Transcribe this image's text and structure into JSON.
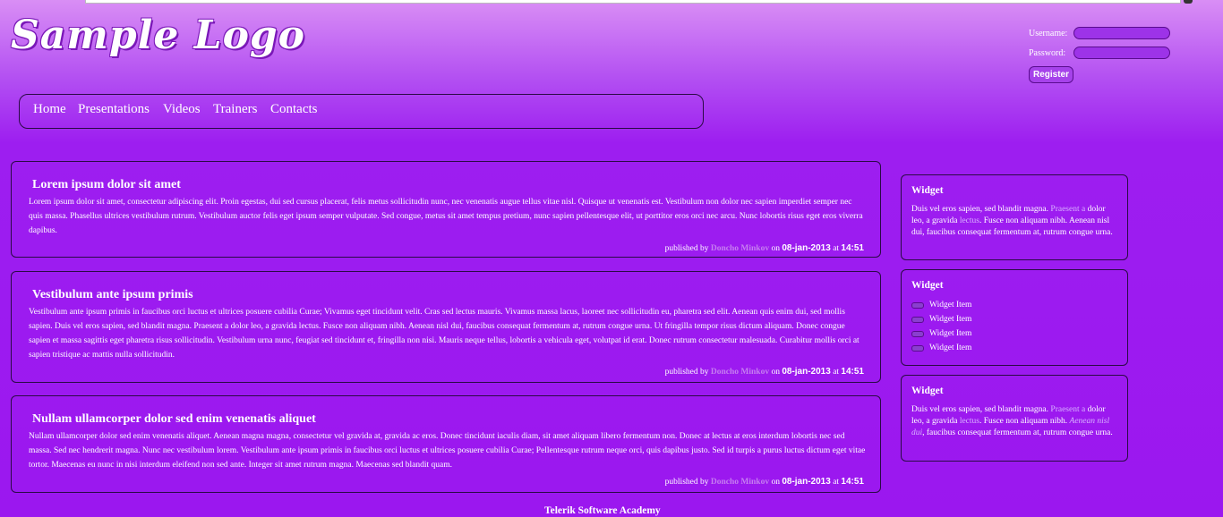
{
  "logo": "Sample Logo",
  "login": {
    "username_label": "Username:",
    "password_label": "Password:",
    "register_label": "Register"
  },
  "nav": [
    "Home",
    "Presentations",
    "Videos",
    "Trainers",
    "Contacts"
  ],
  "articles": [
    {
      "title": "Lorem ipsum dolor sit amet",
      "body": "Lorem ipsum dolor sit amet, consectetur adipiscing elit. Proin egestas, dui sed cursus placerat, felis metus sollicitudin nunc, nec venenatis augue tellus vitae nisl. Quisque ut venenatis est. Vestibulum non dolor nec sapien imperdiet semper nec quis massa. Phasellus ultrices vestibulum rutrum. Vestibulum auctor felis eget ipsum semper vulputate. Sed congue, metus sit amet tempus pretium, nunc sapien pellentesque elit, ut porttitor eros orci nec arcu. Nunc lobortis risus eget eros viverra dapibus.",
      "author": "Doncho Minkov",
      "date": "08-jan-2013",
      "time": "14:51"
    },
    {
      "title": "Vestibulum ante ipsum primis",
      "body": "Vestibulum ante ipsum primis in faucibus orci luctus et ultrices posuere cubilia Curae; Vivamus eget tincidunt velit. Cras sed lectus mauris. Vivamus massa lacus, laoreet nec sollicitudin eu, pharetra sed elit. Aenean quis enim dui, sed mollis sapien. Duis vel eros sapien, sed blandit magna. Praesent a dolor leo, a gravida lectus. Fusce non aliquam nibh. Aenean nisl dui, faucibus consequat fermentum at, rutrum congue urna. Ut fringilla tempor risus dictum aliquam. Donec congue sapien et massa sagittis eget pharetra risus sollicitudin. Vestibulum urna nunc, feugiat sed tincidunt et, fringilla non nisi. Mauris neque tellus, lobortis a vehicula eget, volutpat id erat. Donec rutrum consectetur malesuada. Curabitur mollis orci at sapien tristique ac mattis nulla sollicitudin.",
      "author": "Doncho Minkov",
      "date": "08-jan-2013",
      "time": "14:51"
    },
    {
      "title": "Nullam ullamcorper dolor sed enim venenatis aliquet",
      "body": "Nullam ullamcorper dolor sed enim venenatis aliquet. Aenean magna magna, consectetur vel gravida at, gravida ac eros. Donec tincidunt iaculis diam, sit amet aliquam libero fermentum non. Donec at lectus at eros interdum lobortis nec sed massa. Sed nec hendrerit magna. Nunc nec vestibulum lorem. Vestibulum ante ipsum primis in faucibus orci luctus et ultrices posuere cubilia Curae; Pellentesque rutrum neque orci, quis dapibus justo. Sed id turpis a purus luctus dictum eget vitae tortor. Maecenas eu nunc in nisi interdum eleifend non sed ante. Integer sit amet rutrum magna. Maecenas sed blandit quam.",
      "author": "Doncho Minkov",
      "date": "08-jan-2013",
      "time": "14:51"
    }
  ],
  "meta_words": {
    "published_by": "published by",
    "on": "on",
    "at": "at"
  },
  "widgets": [
    {
      "title": "Widget",
      "t1": "Duis vel eros sapien, sed blandit magna.",
      "t2": "Praesent a",
      "t3": "dolor leo, a gravida",
      "t4": "lectus",
      "t5": ". Fusce non aliquam nibh. Aenean nisl dui, faucibus consequat fermentum at, rutrum congue urna."
    },
    {
      "title": "Widget",
      "items": [
        "Widget Item",
        "Widget Item",
        "Widget Item",
        "Widget Item"
      ]
    },
    {
      "title": "Widget",
      "t1": "Duis vel eros sapien, sed blandit magna.",
      "t2": "Praesent a",
      "t3": "dolor leo, a gravida",
      "t4": "lectus",
      "t5": ". Fusce non aliquam nibh.",
      "t6": "Aenean nisl dui",
      "t7": ", faucibus consequat fermentum at, rutrum congue urna."
    }
  ],
  "footer": "Telerik Software Academy",
  "colors": {
    "background": "#9b17ef",
    "link": "#c67ef0",
    "border": "#2a0a45"
  }
}
